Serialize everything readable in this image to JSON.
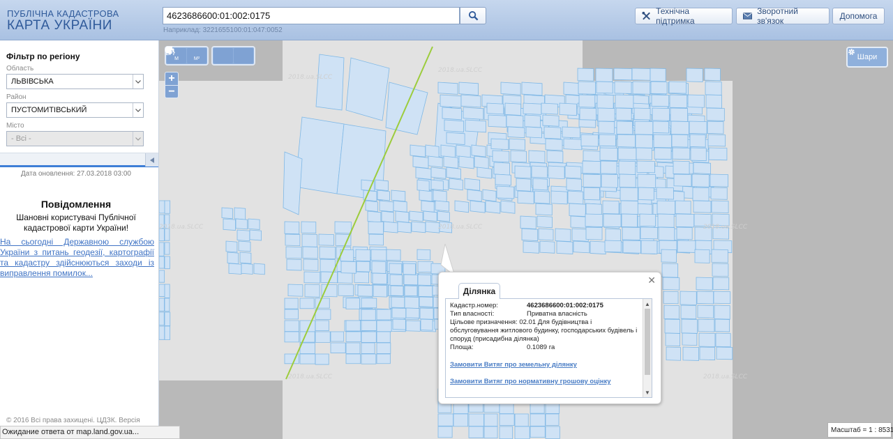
{
  "header": {
    "logo_line1": "ПУБЛІЧНА КАДАСТРОВА",
    "logo_line2": "КАРТА УКРАЇНИ",
    "search_value": "4623686600:01:002:0175",
    "search_hint": "Наприклад: 3221655100:01:047:0052",
    "support_label": "Технічна підтримка",
    "feedback_label": "Зворотний зв'язок",
    "help_label": "Допомога"
  },
  "sidebar": {
    "filter_title": "Фільтр по регіону",
    "oblast_label": "Область",
    "oblast_value": "ЛЬВІВСЬКА",
    "raion_label": "Район",
    "raion_value": "ПУСТОМИТІВСЬКИЙ",
    "city_label": "Місто",
    "city_value": "- Всі -",
    "update_date": "Дата оновлення: 27.03.2018 03:00",
    "notice_title": "Повідомлення",
    "notice_text": "Шановні користувачі Публічної кадастрової карти України!",
    "notice_link": "На сьогодні Державною службою України з питань геодезії, картографії та кадастру здійснюються заходи із виправлення помилок...",
    "copyright": "© 2016 Всі права захищені. ЦДЗК. Версія"
  },
  "status": {
    "text": "Ожидание ответа от map.land.gov.ua..."
  },
  "map": {
    "layers_label": "Шари",
    "scale_text": "Масштаб = 1 : 8531",
    "watermark": "2018.ua.SLCC",
    "tools": {
      "measure_length": "M",
      "measure_area": "M²"
    }
  },
  "popup": {
    "tab_label": "Ділянка",
    "fields": [
      {
        "key": "Кадастр.номер:",
        "value": "4623686600:01:002:0175"
      },
      {
        "key": "Тип власності:",
        "value": "Приватна власність"
      },
      {
        "key": "Цільове призначення:",
        "value": "02.01 Для будівництва і обслуговування житлового будинку, господарських будівель і споруд (присадибна ділянка)"
      },
      {
        "key": "Площа:",
        "value": "0.1089 га"
      }
    ],
    "link1": "Замовити Витяг про земельну ділянку",
    "link2": "Замовити Витяг про нормативну грошову оцінку"
  },
  "colors": {
    "header_bg": "#b4c9e6",
    "map_tool": "#7fa2d3",
    "parcel_fill": "#cfe2f5",
    "parcel_stroke": "#7fb8e6",
    "boundary_line": "#9ccc3c",
    "link": "#4a7dc5"
  }
}
